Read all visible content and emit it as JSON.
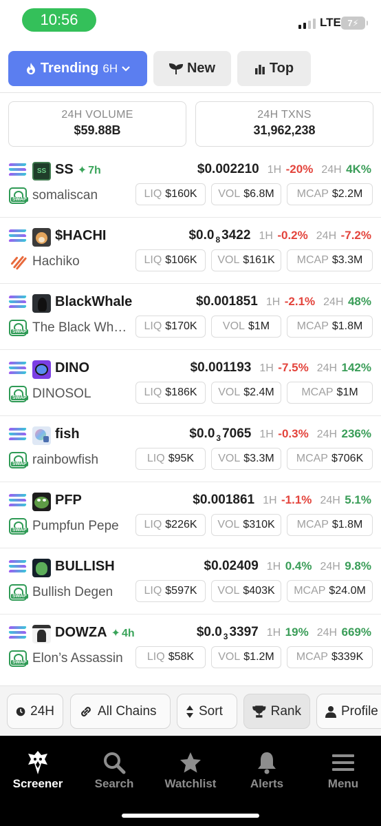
{
  "status_bar": {
    "time": "10:56",
    "network": "LTE",
    "battery": "7"
  },
  "tabs": {
    "trending_label": "Trending",
    "trending_timeframe": "6H",
    "new_label": "New",
    "top_label": "Top"
  },
  "stats": {
    "volume_label": "24H VOLUME",
    "volume_value": "$59.88B",
    "txns_label": "24H TXNS",
    "txns_value": "31,962,238"
  },
  "labels": {
    "h1": "1H",
    "h24": "24H",
    "liq": "LIQ",
    "vol": "VOL",
    "mcap": "MCAP"
  },
  "tokens": [
    {
      "symbol": "SS",
      "age": "7h",
      "name": "somaliscan",
      "price": "$0.002210",
      "chg_1h": "-20%",
      "chg_24h": "4K%",
      "liq": "$160K",
      "vol": "$6.8M",
      "mcap": "$2.2M"
    },
    {
      "symbol": "$HACHI",
      "name": "Hachiko",
      "price_prefix": "$0.0",
      "price_zeros": "8",
      "price_digits": "3422",
      "chg_1h": "-0.2%",
      "chg_24h": "-7.2%",
      "liq": "$106K",
      "vol": "$161K",
      "mcap": "$3.3M"
    },
    {
      "symbol": "BlackWhale",
      "name": "The Black Wh…",
      "price": "$0.001851",
      "chg_1h": "-2.1%",
      "chg_24h": "48%",
      "liq": "$170K",
      "vol": "$1M",
      "mcap": "$1.8M"
    },
    {
      "symbol": "DINO",
      "name": "DINOSOL",
      "price": "$0.001193",
      "chg_1h": "-7.5%",
      "chg_24h": "142%",
      "liq": "$186K",
      "vol": "$2.4M",
      "mcap": "$1M"
    },
    {
      "symbol": "fish",
      "name": "rainbowfish",
      "price_prefix": "$0.0",
      "price_zeros": "3",
      "price_digits": "7065",
      "chg_1h": "-0.3%",
      "chg_24h": "236%",
      "liq": "$95K",
      "vol": "$3.3M",
      "mcap": "$706K"
    },
    {
      "symbol": "PFP",
      "name": "Pumpfun Pepe",
      "price": "$0.001861",
      "chg_1h": "-1.1%",
      "chg_24h": "5.1%",
      "liq": "$226K",
      "vol": "$310K",
      "mcap": "$1.8M"
    },
    {
      "symbol": "BULLISH",
      "name": "Bullish Degen",
      "price": "$0.02409",
      "chg_1h": "0.4%",
      "chg_24h": "9.8%",
      "liq": "$597K",
      "vol": "$403K",
      "mcap": "$24.0M"
    },
    {
      "symbol": "DOWZA",
      "age": "4h",
      "name": "Elon’s Assassin",
      "price_prefix": "$0.0",
      "price_zeros": "3",
      "price_digits": "3397",
      "chg_1h": "19%",
      "chg_24h": "669%",
      "liq": "$58K",
      "vol": "$1.2M",
      "mcap": "$339K"
    }
  ],
  "filters": {
    "timeframe": "24H",
    "chains": "All Chains",
    "sort": "Sort",
    "rank": "Rank",
    "profile": "Profile"
  },
  "nav": {
    "screener": "Screener",
    "search": "Search",
    "watchlist": "Watchlist",
    "alerts": "Alerts",
    "menu": "Menu"
  },
  "colors": {
    "accent": "#5b7ef0",
    "positive": "#3a9d58",
    "negative": "#e3443c",
    "status_pill": "#34c05a"
  }
}
